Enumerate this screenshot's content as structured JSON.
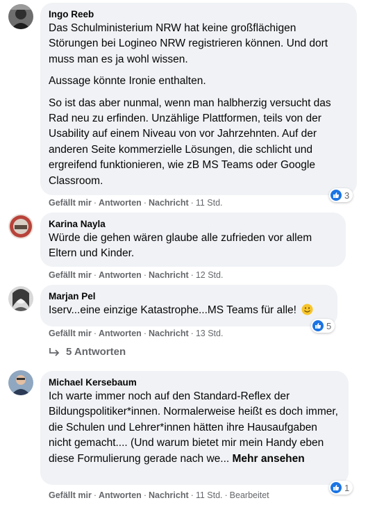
{
  "comments": [
    {
      "author": "Ingo Reeb",
      "paragraphs": [
        "Das Schulministerium NRW hat keine großflächigen Störungen bei Logineo NRW registrieren können. Und dort muss man es ja wohl wissen.",
        "Aussage könnte Ironie enthalten.",
        "So ist das aber nunmal, wenn man halbherzig versucht das Rad neu zu erfinden. Unzählige Plattformen, teils von der Usability auf einem Niveau von vor Jahrzehnten. Auf der anderen Seite kommerzielle Lösungen, die schlicht und ergreifend funktionieren, wie zB MS Teams oder Google Classroom."
      ],
      "like": "Gefällt mir",
      "reply": "Antworten",
      "message": "Nachricht",
      "time": "11 Std.",
      "reactions": "3"
    },
    {
      "author": "Karina Nayla",
      "paragraphs": [
        "Würde die gehen wären glaube alle zufrieden vor allem Eltern und Kinder."
      ],
      "like": "Gefällt mir",
      "reply": "Antworten",
      "message": "Nachricht",
      "time": "12 Std."
    },
    {
      "author": "Marjan Pel",
      "paragraphs": [
        "Iserv...eine einzige Katastrophe...MS Teams für alle!"
      ],
      "like": "Gefällt mir",
      "reply": "Antworten",
      "message": "Nachricht",
      "time": "13 Std.",
      "reactions": "5"
    },
    {
      "author": "Michael Kersebaum",
      "paragraphs": [
        "Ich warte immer noch auf den Standard-Reflex der Bildungspolitiker*innen. Normalerweise heißt es doch immer, die Schulen und Lehrer*innen hätten ihre Hausaufgaben nicht gemacht.... (Und warum bietet mir mein Handy eben diese Formulierung gerade nach we..."
      ],
      "see_more": "Mehr ansehen",
      "like": "Gefällt mir",
      "reply": "Antworten",
      "message": "Nachricht",
      "time": "11 Std.",
      "edited": "Bearbeitet",
      "reactions": "1"
    }
  ],
  "replies_link": "5 Antworten",
  "colors": {
    "bubble": "#f0f2f5",
    "meta": "#65676b",
    "like_blue": "#1b74e4"
  }
}
